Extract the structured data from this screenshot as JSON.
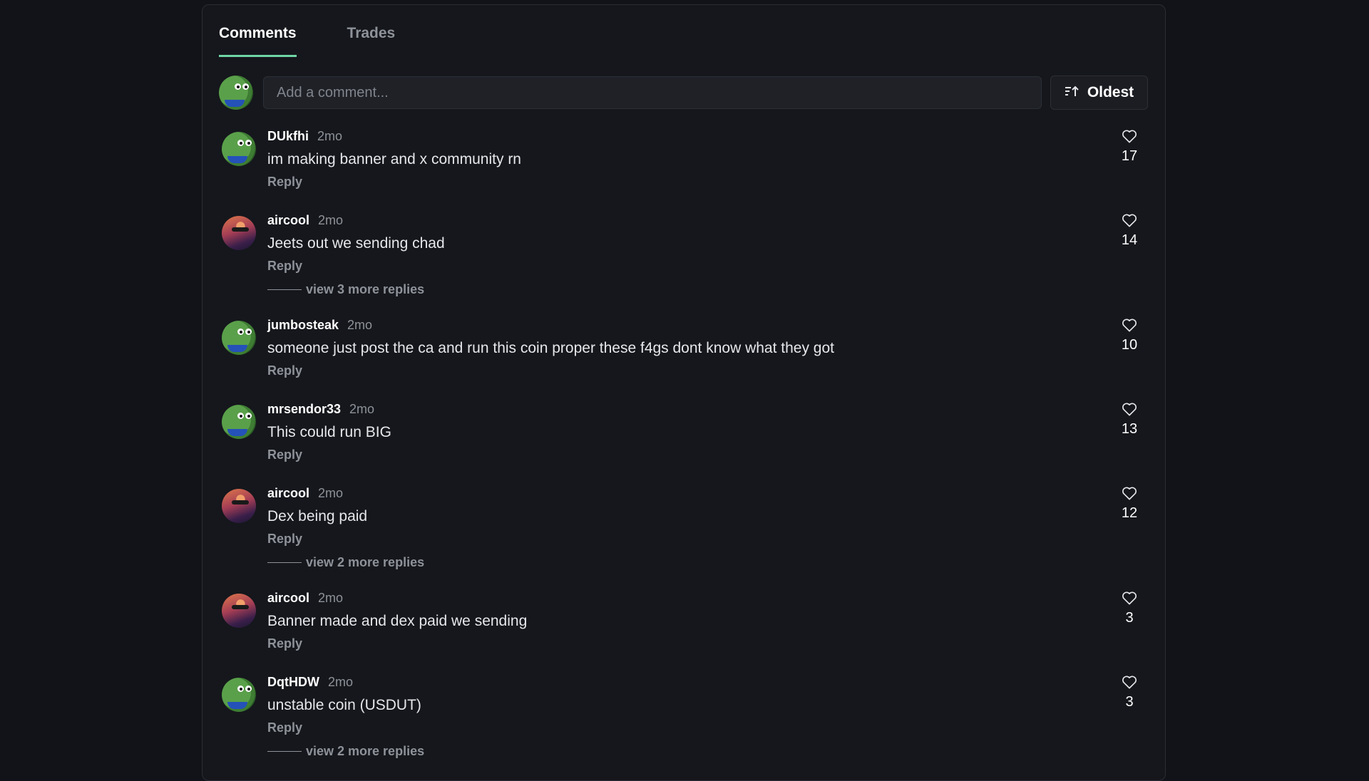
{
  "tabs": [
    {
      "label": "Comments",
      "active": true
    },
    {
      "label": "Trades",
      "active": false
    }
  ],
  "composer": {
    "placeholder": "Add a comment...",
    "sort_label": "Oldest",
    "sort_icon": "sort-ascending-icon"
  },
  "colors": {
    "background": "#111318",
    "panel": "#15171c",
    "accent": "#6fd6a6",
    "muted_text": "#8e9299"
  },
  "comments": [
    {
      "username": "DUkfhi",
      "time": "2mo",
      "text": "im making banner and x community rn",
      "reply_label": "Reply",
      "likes": "17",
      "avatar": "pepe",
      "replies_label": ""
    },
    {
      "username": "aircool",
      "time": "2mo",
      "text": "Jeets out we sending chad",
      "reply_label": "Reply",
      "likes": "14",
      "avatar": "aircool",
      "replies_label": "view 3 more replies"
    },
    {
      "username": "jumbosteak",
      "time": "2mo",
      "text": "someone just post the ca and run this coin proper these f4gs dont know what they got",
      "reply_label": "Reply",
      "likes": "10",
      "avatar": "pepe",
      "replies_label": ""
    },
    {
      "username": "mrsendor33",
      "time": "2mo",
      "text": "This could run BIG",
      "reply_label": "Reply",
      "likes": "13",
      "avatar": "pepe",
      "replies_label": ""
    },
    {
      "username": "aircool",
      "time": "2mo",
      "text": "Dex being paid",
      "reply_label": "Reply",
      "likes": "12",
      "avatar": "aircool",
      "replies_label": "view 2 more replies"
    },
    {
      "username": "aircool",
      "time": "2mo",
      "text": "Banner made and dex paid we sending",
      "reply_label": "Reply",
      "likes": "3",
      "avatar": "aircool",
      "replies_label": ""
    },
    {
      "username": "DqtHDW",
      "time": "2mo",
      "text": "unstable coin (USDUT)",
      "reply_label": "Reply",
      "likes": "3",
      "avatar": "pepe",
      "replies_label": "view 2 more replies"
    }
  ]
}
